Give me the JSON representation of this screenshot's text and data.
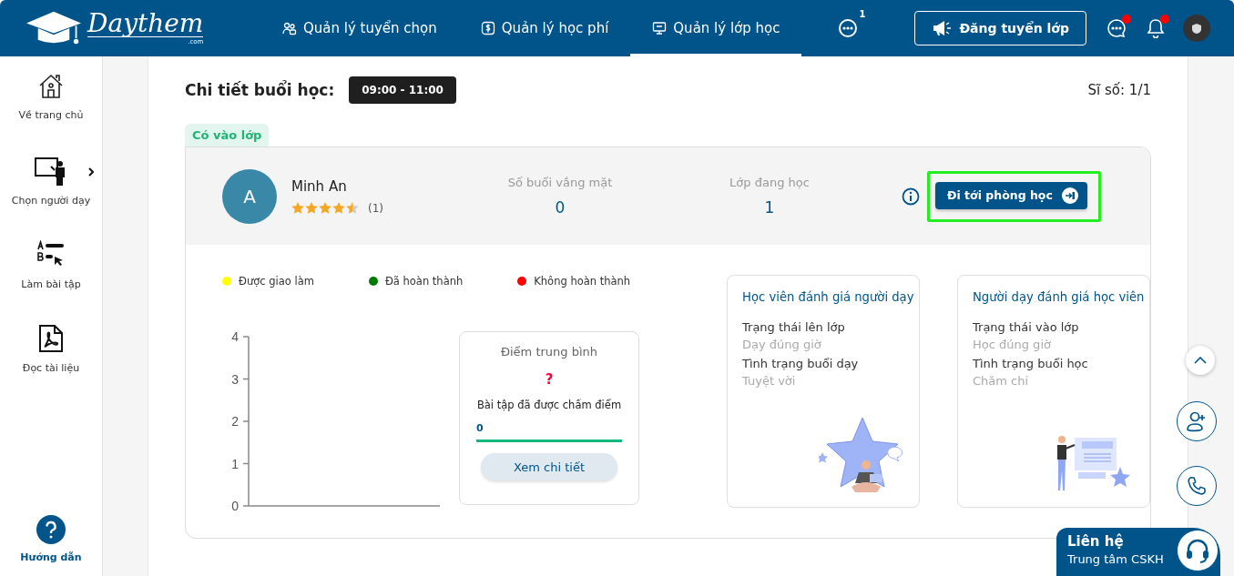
{
  "header": {
    "logo": {
      "name": "Daythem",
      "suffix": ".com"
    },
    "nav": [
      {
        "label": "Quản lý tuyển chọn",
        "selected": false
      },
      {
        "label": "Quản lý học phí",
        "selected": false
      },
      {
        "label": "Quản lý lớp học",
        "selected": true
      }
    ],
    "more_badge": "1",
    "post_button": "Đăng tuyển lớp",
    "chat_unread": true,
    "bell_unread": true
  },
  "sidebar": {
    "items": [
      {
        "label": "Về trang chủ",
        "expandable": false
      },
      {
        "label": "Chọn người dạy",
        "expandable": true
      },
      {
        "label": "Làm bài tập",
        "expandable": false
      },
      {
        "label": "Đọc tài liệu",
        "expandable": false
      }
    ],
    "help": "Hướng dẫn"
  },
  "session": {
    "title": "Chi tiết buổi học:",
    "time": "09:00 - 11:00",
    "count": "Sĩ số: 1/1",
    "status_tab": "Có vào lớp",
    "student": {
      "initial": "A",
      "name": "Minh An",
      "stars": 4.5,
      "rating_count": "(1)"
    },
    "stats": [
      {
        "label": "Số buổi vắng mặt",
        "value": "0"
      },
      {
        "label": "Lớp đang học",
        "value": "1"
      }
    ],
    "room_button": "Đi tới phòng học",
    "room_button_highlighted": true,
    "legend": [
      {
        "label": "Được giao làm",
        "color": "#ffff00"
      },
      {
        "label": "Đã hoàn thành",
        "color": "#007a00"
      },
      {
        "label": "Không hoàn thành",
        "color": "#ff0000"
      }
    ],
    "axis_labels": [
      "4",
      "3",
      "2",
      "1",
      "0"
    ],
    "score": {
      "title": "Điểm trung bình",
      "value": "?",
      "graded_label": "Bài tập đã được chấm điểm",
      "graded_value": "0",
      "level": 1,
      "button": "Xem chi tiết"
    },
    "reviews": [
      {
        "title": "Học viên đánh giá người dạy",
        "fields": [
          {
            "label": "Trạng thái lên lớp",
            "value": "Dạy đúng giờ"
          },
          {
            "label": "Tình trạng buổi dạy",
            "value": "Tuyệt vời"
          }
        ]
      },
      {
        "title": "Người dạy đánh giá học viên",
        "fields": [
          {
            "label": "Trạng thái vào lớp",
            "value": "Học đúng giờ"
          },
          {
            "label": "Tình trạng buổi học",
            "value": "Chăm chỉ"
          }
        ]
      }
    ]
  },
  "contact": {
    "title": "Liên hệ",
    "subtitle": "Trung tâm CSKH"
  }
}
